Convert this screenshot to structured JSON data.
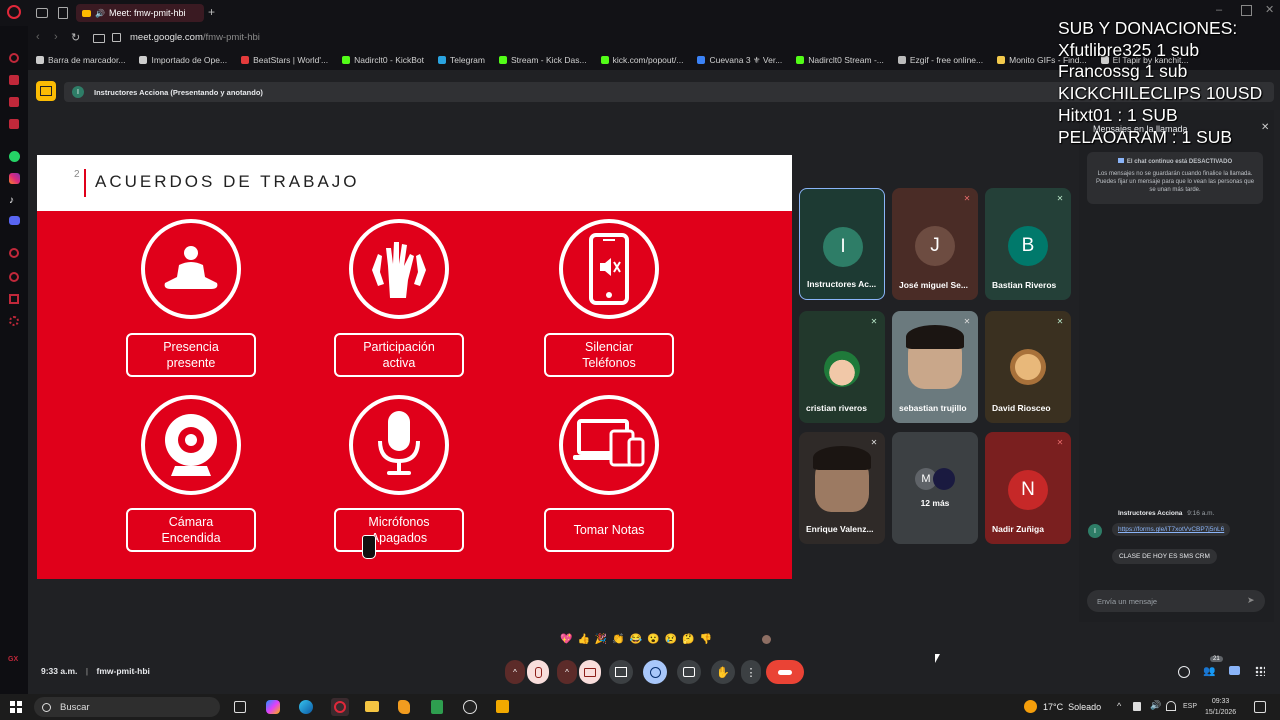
{
  "browser": {
    "active_tab": "Meet: fmw-pmit-hbi",
    "url_host": "meet.google.com",
    "url_path": "/fmw-pmit-hbi",
    "bookmarks": [
      {
        "label": "Barra de marcador...",
        "color": "#cccccc"
      },
      {
        "label": "Importado de Ope...",
        "color": "#cccccc"
      },
      {
        "label": "BeatStars | World'...",
        "color": "#e33b3b"
      },
      {
        "label": "Nadirclt0 - KickBot",
        "color": "#53fc18"
      },
      {
        "label": "Telegram",
        "color": "#2aa3df"
      },
      {
        "label": "Stream - Kick Das...",
        "color": "#53fc18"
      },
      {
        "label": "kick.com/popout/...",
        "color": "#53fc18"
      },
      {
        "label": "Cuevana 3 ⚜ Ver...",
        "color": "#3b82f6"
      },
      {
        "label": "Nadirclt0 Stream -...",
        "color": "#53fc18"
      },
      {
        "label": "Ezgif - free online...",
        "color": "#bbbbbb"
      },
      {
        "label": "Monito GIFs - Find...",
        "color": "#f2c94c"
      },
      {
        "label": "El Tapir by kanchit...",
        "color": "#cccccc"
      }
    ]
  },
  "meet": {
    "presenting_banner": "Instructores Acciona (Presentando y anotando)",
    "time": "9:33 a.m.",
    "meeting_code": "fmw-pmit-hbi",
    "people_count": "21"
  },
  "slide": {
    "number": "2",
    "title": "ACUERDOS DE TRABAJO",
    "items": [
      {
        "label": "Presencia\npresente",
        "icon": "meditation-icon"
      },
      {
        "label": "Participación\nactiva",
        "icon": "raised-hands-icon"
      },
      {
        "label": "Silenciar\nTeléfonos",
        "icon": "muted-phone-icon"
      },
      {
        "label": "Cámara\nEncendida",
        "icon": "webcam-icon"
      },
      {
        "label": "Micrófonos\nApagados",
        "icon": "microphone-icon"
      },
      {
        "label": "Tomar Notas",
        "icon": "devices-icon"
      }
    ]
  },
  "participants": [
    {
      "name": "Instructores Ac...",
      "initial": "I",
      "color": "#2e7d67"
    },
    {
      "name": "José miguel Se...",
      "initial": "J",
      "color": "#6d4c41"
    },
    {
      "name": "Bastian Riveros",
      "initial": "B",
      "color": "#00796b"
    },
    {
      "name": "cristian riveros",
      "initial": "",
      "color": "#2b4a3a"
    },
    {
      "name": "sebastian trujillo",
      "initial": "",
      "color": "#5a5a5a"
    },
    {
      "name": "David Riosceo",
      "initial": "",
      "color": "#4a3b1f"
    },
    {
      "name": "Enrique Valenz...",
      "initial": "",
      "color": "#2b2b2b"
    },
    {
      "name": "12 más",
      "initial": "M",
      "color": "#3c4043"
    },
    {
      "name": "Nadir Zuñiga",
      "initial": "N",
      "color": "#c62828"
    }
  ],
  "chat": {
    "header": "Mensajes en la llamada",
    "notice_title": "El chat continuo está DESACTIVADO",
    "notice_body": "Los mensajes no se guardarán cuando finalice la llamada. Puedes fijar un mensaje para que lo vean las personas que se unan más tarde.",
    "sender": "Instructores Acciona",
    "sent_time": "9:16 a.m.",
    "link": "https://forms.gle/iT7xotVvCBP7j5nL6",
    "message": "CLASE DE HOY ES SMS CRM",
    "input_placeholder": "Envía un mensaje"
  },
  "reactions": [
    "💖",
    "👍",
    "🎉",
    "👏",
    "😂",
    "😮",
    "😢",
    "🤔",
    "👎"
  ],
  "stream_overlay": [
    "SUB Y DONACIONES:",
    "Xfutlibre325 1 sub",
    "Francossg 1 sub",
    "KICKCHILECLIPS 10USD",
    "Hitxt01 : 1 SUB",
    "PELAOARAM : 1 SUB"
  ],
  "taskbar": {
    "search_placeholder": "Buscar",
    "weather": "17°C  Soleado",
    "lang": "ESP",
    "clock_time": "09:33",
    "clock_date": "15/1/2026"
  },
  "colors": {
    "slide_red": "#e0001a",
    "meet_bg": "#202124",
    "hangup": "#ea4335"
  }
}
